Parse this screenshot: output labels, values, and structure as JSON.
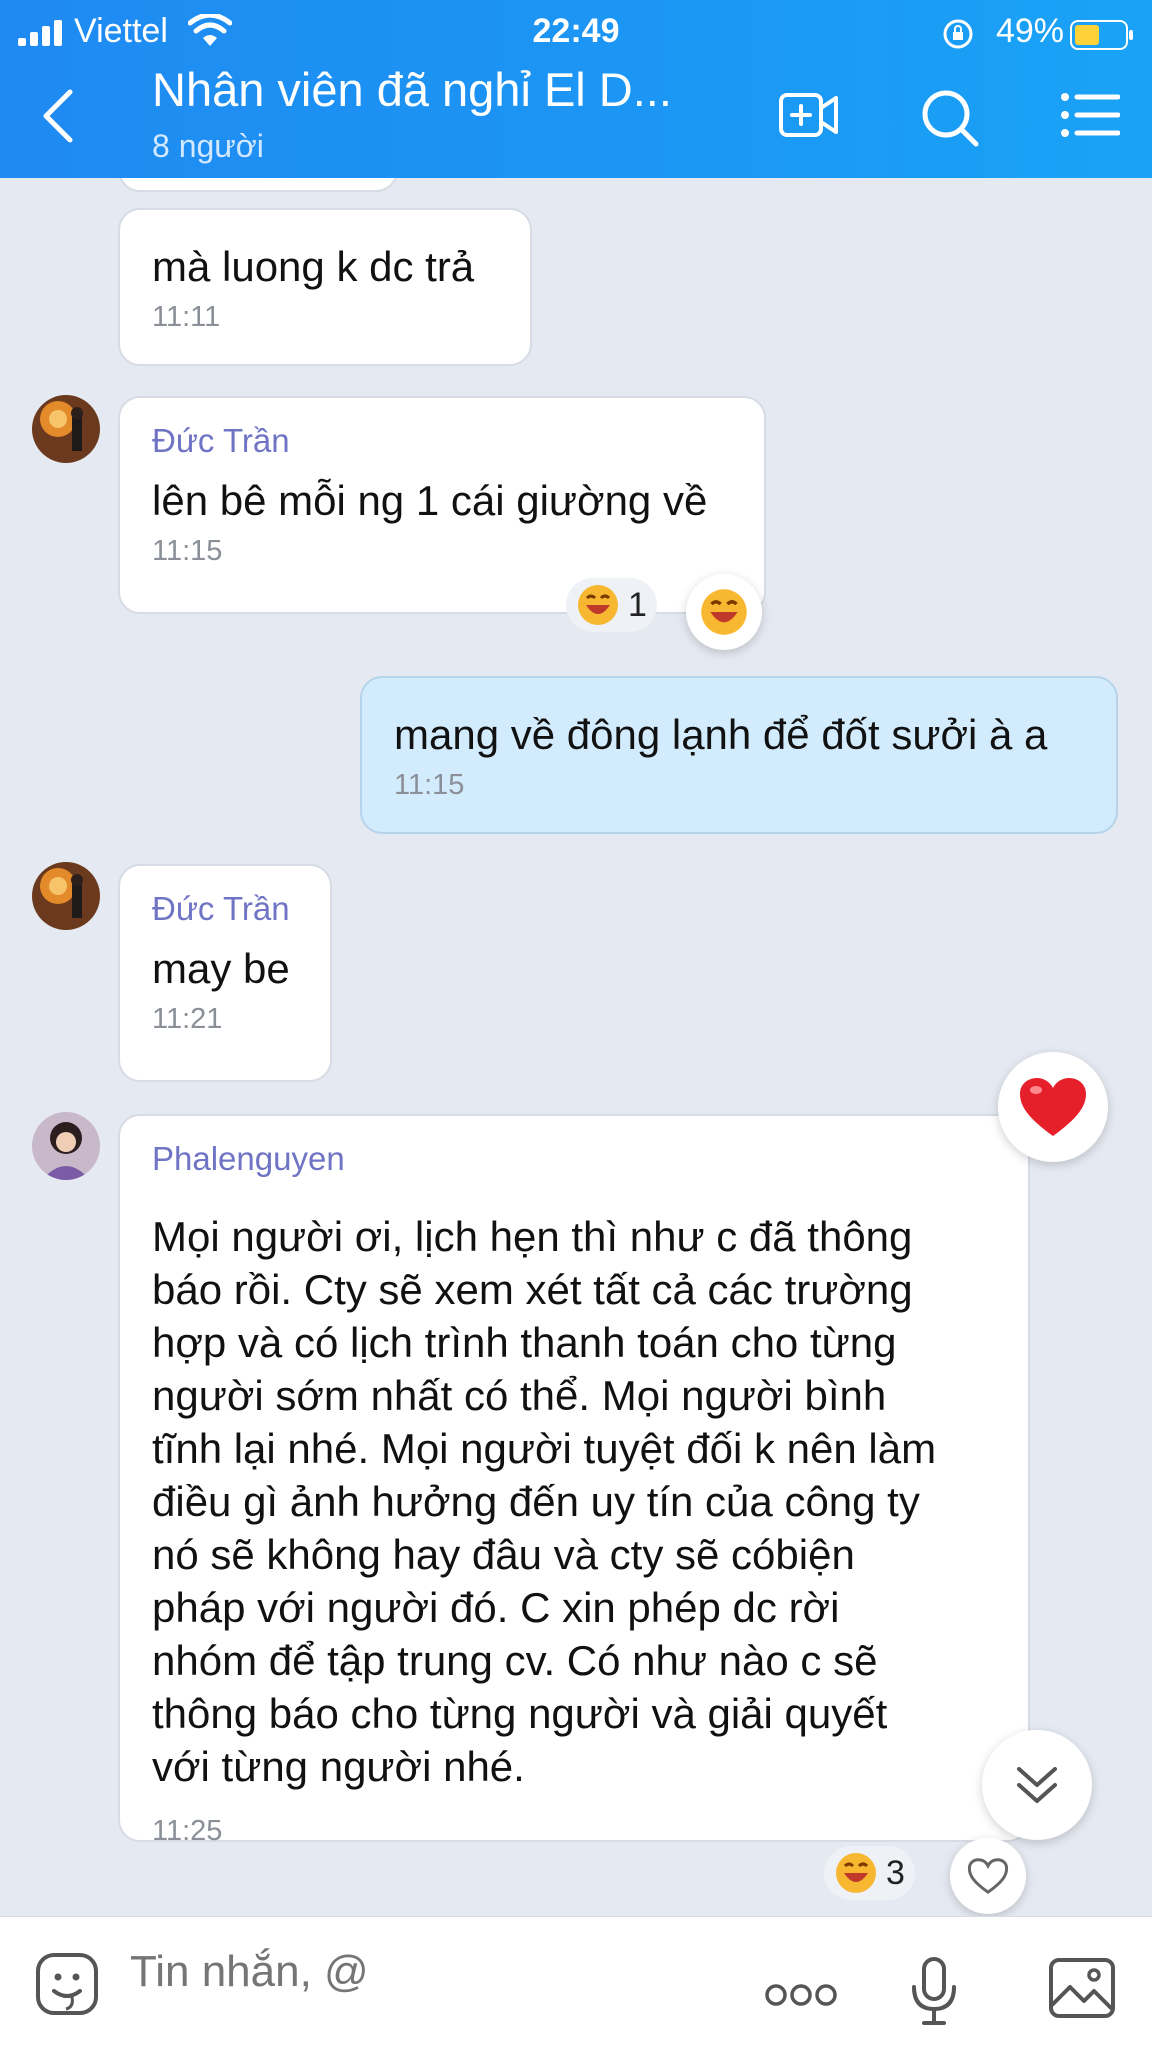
{
  "status": {
    "carrier": "Viettel",
    "time": "22:49",
    "battery": "49%"
  },
  "header": {
    "title": "Nhân viên đã nghỉ El D...",
    "subtitle": "8 người",
    "icons": [
      "back-icon",
      "video-call-icon",
      "search-icon",
      "menu-icon"
    ]
  },
  "messages": [
    {
      "text": "mà luong k dc trả",
      "time": "11:11"
    },
    {
      "sender": "Đức Trần",
      "text": "lên bê mỗi ng 1 cái giường về",
      "time": "11:15",
      "reaction_count": "1"
    },
    {
      "text": "mang về đông lạnh để đốt sưởi à a",
      "time": "11:15"
    },
    {
      "sender": "Đức Trần",
      "text": "may be",
      "time": "11:21"
    },
    {
      "sender": "Phalenguyen",
      "lines": [
        "Mọi người ơi, lịch hẹn thì như c đã thông",
        "báo rồi. Cty sẽ xem xét tất cả các trường",
        "hợp và có lịch trình thanh toán cho từng",
        "người sớm nhất có thể. Mọi người bình",
        "tĩnh lại nhé. Mọi người tuyệt đối k nên làm",
        "điều gì ảnh hưởng đến uy tín của công ty",
        "nó sẽ không hay đâu và cty sẽ cóbiện",
        "pháp với người đó. C xin phép dc rời",
        "nhóm để tập trung cv. Có như nào c sẽ",
        "thông báo cho từng người và giải quyết",
        "với từng người nhé."
      ],
      "time": "11:25",
      "reaction_count": "3"
    }
  ],
  "composer": {
    "placeholder": "Tin nhắn, @",
    "icons": [
      "sticker-icon",
      "more-icon",
      "microphone-icon",
      "image-icon"
    ]
  },
  "colors": {
    "header": "#1b97f4",
    "chat_bg": "#e5e9f1",
    "my_bubble": "#d3ecfd",
    "sender_name": "#6f74c4"
  }
}
